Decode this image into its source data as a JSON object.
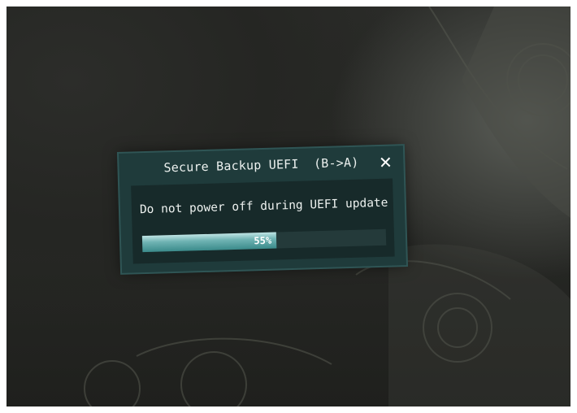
{
  "dialog": {
    "title": "Secure Backup UEFI  (B->A)",
    "close_icon": "close-icon",
    "message": "Do not power off during UEFI update",
    "progress_text": "55%",
    "progress_fraction": 0.55
  },
  "colors": {
    "dialog_background": "#1f3b3b",
    "progress_fill": "#5fa8a8",
    "text": "#eef2f0"
  }
}
